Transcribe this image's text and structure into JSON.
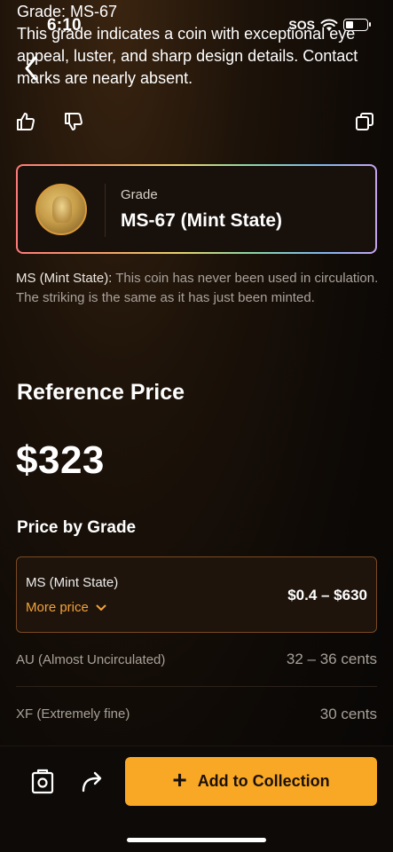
{
  "status": {
    "time": "6:10",
    "sos": "SOS",
    "battery_level": 0.3
  },
  "assistant_message": {
    "grade_line": "Grade: MS-67",
    "description": "This grade indicates a coin with exceptional eye appeal, luster, and sharp design details. Contact marks are nearly absent."
  },
  "grade_card": {
    "label": "Grade",
    "value": "MS-67 (Mint State)"
  },
  "ms_description": {
    "lead": "MS (Mint State):",
    "text": " This coin has never been used in circulation. The striking is the same as it has just been minted."
  },
  "reference": {
    "title": "Reference Price",
    "price": "$323"
  },
  "price_by_grade": {
    "title": "Price by Grade",
    "expanded": {
      "name": "MS (Mint State)",
      "more_label": "More price",
      "range": "$0.4 – $630"
    },
    "rows": [
      {
        "name": "AU (Almost Uncirculated)",
        "value": "32 – 36 cents"
      },
      {
        "name": "XF (Extremely fine)",
        "value": "30 cents"
      }
    ]
  },
  "bottom_bar": {
    "add_label": "Add to Collection"
  },
  "colors": {
    "accent": "#f9a825",
    "link": "#f4a23a",
    "background": "#0d0906"
  }
}
